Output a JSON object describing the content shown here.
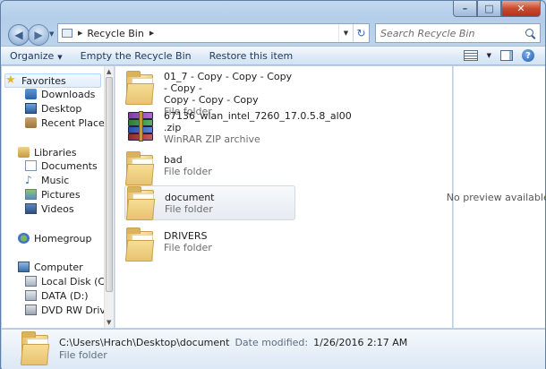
{
  "window": {
    "caption": {
      "minimize": "–",
      "maximize": "□",
      "close": "✕"
    }
  },
  "address": {
    "path": "Recycle Bin",
    "search_placeholder": "Search Recycle Bin"
  },
  "toolbar": {
    "organize": "Organize",
    "empty": "Empty the Recycle Bin",
    "restore": "Restore this item",
    "help": "?"
  },
  "nav": {
    "favorites": "Favorites",
    "downloads": "Downloads",
    "desktop": "Desktop",
    "recent": "Recent Places",
    "libraries": "Libraries",
    "documents": "Documents",
    "music": "Music",
    "pictures": "Pictures",
    "videos": "Videos",
    "homegroup": "Homegroup",
    "computer": "Computer",
    "local_disk": "Local Disk (C:)",
    "data": "DATA (D:)",
    "dvd": "DVD RW Drive (E:"
  },
  "files": [
    {
      "name_line1": "01_7 - Copy - Copy - Copy - Copy -",
      "name_line2": "Copy - Copy - Copy",
      "type": "File folder",
      "icon": "folder-icon"
    },
    {
      "name_line1": "67136_wlan_intel_7260_17.0.5.8_al00",
      "name_line2": ".zip",
      "type": "WinRAR ZIP archive",
      "icon": "winrar-archive-icon"
    },
    {
      "name_line1": "bad",
      "type": "File folder",
      "icon": "folder-icon"
    },
    {
      "name_line1": "document",
      "type": "File folder",
      "icon": "folder-icon",
      "selected": true
    },
    {
      "name_line1": "DRIVERS",
      "type": "File folder",
      "icon": "folder-icon"
    }
  ],
  "preview": {
    "text": "No preview available."
  },
  "details": {
    "path": "C:\\Users\\Hrach\\Desktop\\document",
    "modified_label": "Date modified:",
    "modified_value": "1/26/2016 2:17 AM",
    "type": "File folder"
  }
}
